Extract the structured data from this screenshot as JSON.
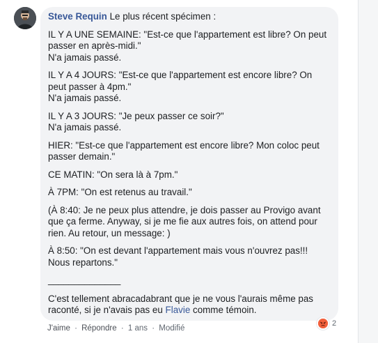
{
  "comment": {
    "author": "Steve Requin",
    "intro": "Le plus récent spécimen :",
    "paragraphs": [
      [
        "IL Y A UNE SEMAINE: \"Est-ce que l'appartement est libre? On peut passer en après-midi.\"",
        "N'a jamais passé."
      ],
      [
        "IL Y A 4 JOURS: \"Est-ce que l'appartement est encore libre? On peut passer à 4pm.\"",
        "N'a jamais passé."
      ],
      [
        "IL Y A 3 JOURS: \"Je peux passer ce soir?\"",
        "N'a jamais passé."
      ],
      [
        "HIER: \"Est-ce que l'appartement est encore libre? Mon coloc peut passer demain.\""
      ],
      [
        "CE MATIN: \"On sera là à 7pm.\""
      ],
      [
        "À 7PM: \"On est retenus au travail.\""
      ],
      [
        "(À 8:40: Je ne peux plus attendre, je dois passer au Provigo avant que ça ferme. Anyway, si je me fie aux autres fois, on attend pour rien. Au retour, un message: )"
      ],
      [
        "À 8:50: \"On est devant l'appartement mais vous n'ouvrez pas!!! Nous repartons.\""
      ]
    ],
    "separator": "______________",
    "closing_before": "C'est tellement abracadabrant que je ne vous l'aurais même pas raconté, si je n'avais pas eu ",
    "mention": "Flavie",
    "closing_after": " comme témoin."
  },
  "actions": {
    "like": "J'aime",
    "reply": "Répondre",
    "time": "1 ans",
    "edited": "Modifié",
    "dot": "·"
  },
  "reaction": {
    "icon": "angry-reaction-icon",
    "count": "2"
  }
}
